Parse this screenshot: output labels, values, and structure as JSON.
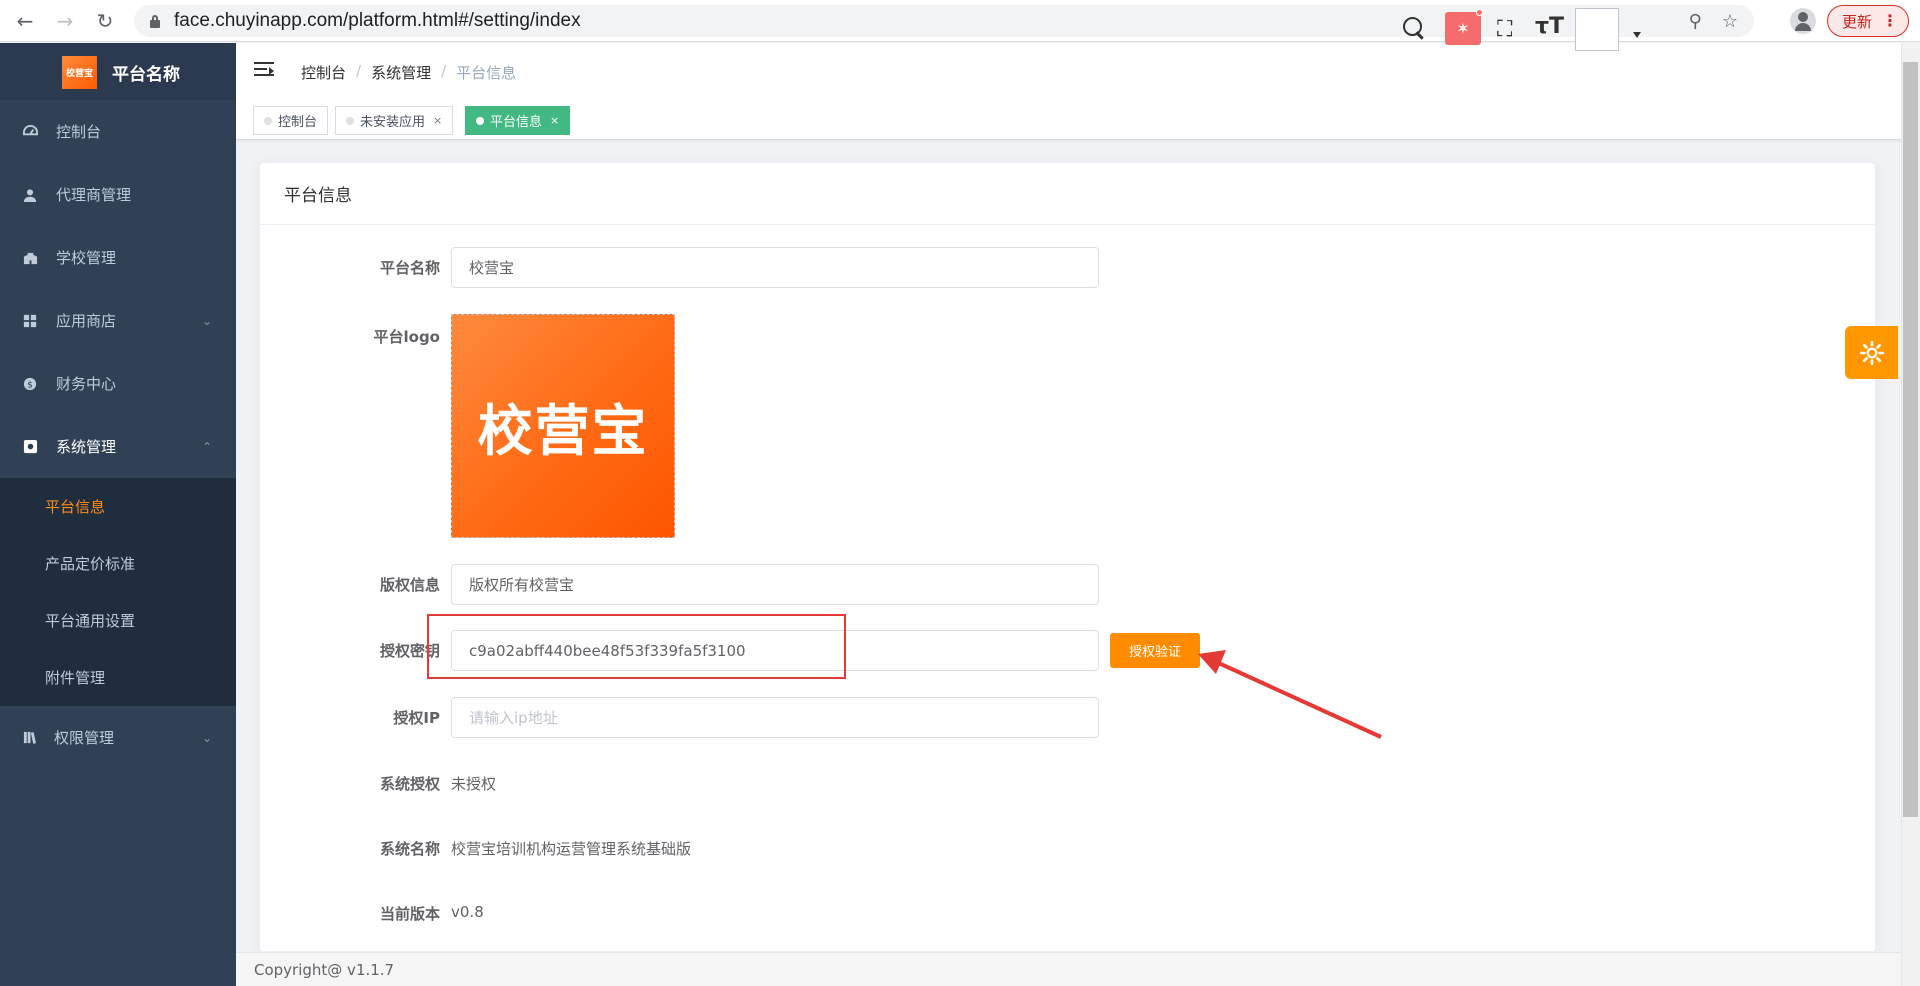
{
  "browser": {
    "url": "face.chuyinapp.com/platform.html#/setting/index",
    "update_label": "更新"
  },
  "sidebar": {
    "brand_logo_text": "校营宝",
    "brand_title": "平台名称",
    "items": [
      {
        "label": "控制台",
        "icon": "dashboard-icon"
      },
      {
        "label": "代理商管理",
        "icon": "user-icon"
      },
      {
        "label": "学校管理",
        "icon": "school-icon"
      },
      {
        "label": "应用商店",
        "icon": "windows-icon"
      },
      {
        "label": "财务中心",
        "icon": "money-icon"
      },
      {
        "label": "系统管理",
        "icon": "settings-box-icon"
      },
      {
        "label": "权限管理",
        "icon": "book-icon"
      }
    ],
    "submenu": [
      {
        "label": "平台信息"
      },
      {
        "label": "产品定价标准"
      },
      {
        "label": "平台通用设置"
      },
      {
        "label": "附件管理"
      }
    ]
  },
  "header": {
    "breadcrumb": [
      "控制台",
      "系统管理",
      "平台信息"
    ]
  },
  "tags": [
    {
      "label": "控制台"
    },
    {
      "label": "未安装应用"
    },
    {
      "label": "平台信息"
    }
  ],
  "card": {
    "title": "平台信息",
    "fields": {
      "platform_name_label": "平台名称",
      "platform_name_value": "校营宝",
      "platform_logo_label": "平台logo",
      "logo_text": "校营宝",
      "copyright_label": "版权信息",
      "copyright_value": "版权所有校营宝",
      "auth_key_label": "授权密钥",
      "auth_key_value": "c9a02abff440bee48f53f339fa5f3100",
      "verify_button": "授权验证",
      "auth_ip_label": "授权IP",
      "auth_ip_placeholder": "请输入ip地址",
      "system_auth_label": "系统授权",
      "system_auth_value": "未授权",
      "system_name_label": "系统名称",
      "system_name_value": "校营宝培训机构运营管理系统基础版",
      "version_label": "当前版本",
      "version_value": "v0.8"
    }
  },
  "footer": {
    "text": "Copyright@ v1.1.7"
  },
  "colors": {
    "sidebar_bg": "#304156",
    "accent_orange": "#ff8c00",
    "active_tag": "#42b983",
    "annotation_red": "#e53935"
  }
}
